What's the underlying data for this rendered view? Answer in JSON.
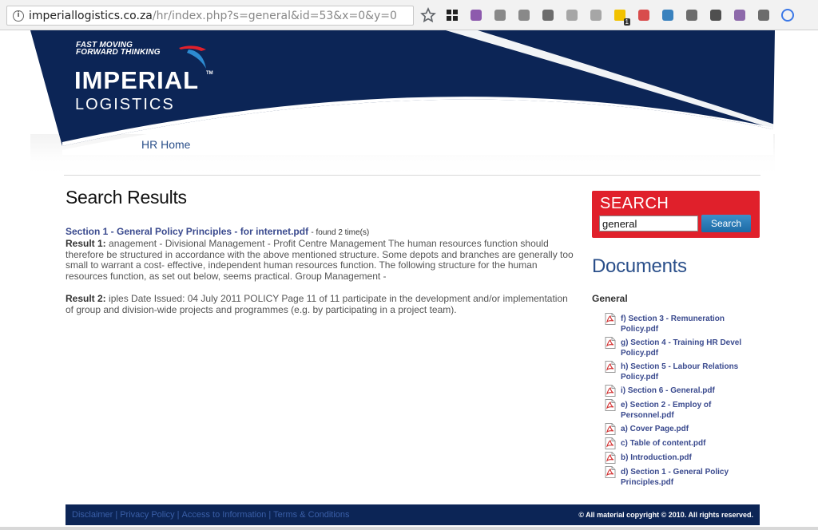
{
  "browser": {
    "url_host": "imperiallogistics.co.za",
    "url_path": "/hr/index.php?s=general&id=53&x=0&y=0",
    "extensions": [
      {
        "name": "bookmark-star-icon",
        "color": "#5f6368"
      },
      {
        "name": "grid-app-icon",
        "color": "#222222"
      },
      {
        "name": "onenote-icon",
        "color": "#7b3fa1"
      },
      {
        "name": "camera-icon",
        "color": "#777777"
      },
      {
        "name": "hourglass-icon",
        "color": "#777777"
      },
      {
        "name": "fish-icon",
        "color": "#555555"
      },
      {
        "name": "drive-icon",
        "color": "#999999"
      },
      {
        "name": "compass-icon",
        "color": "#999999"
      },
      {
        "name": "sticky-note-icon",
        "color": "#f2c200",
        "badge": "1"
      },
      {
        "name": "plus-cross-icon",
        "color": "#d32f2f"
      },
      {
        "name": "board-icon",
        "color": "#1a6fb5"
      },
      {
        "name": "w-circle-icon",
        "color": "#555555"
      },
      {
        "name": "pocket-icon",
        "color": "#333333"
      },
      {
        "name": "viber-icon",
        "color": "#7b519d"
      },
      {
        "name": "s-square-icon",
        "color": "#555555"
      },
      {
        "name": "sync-icon",
        "color": "#3b78e7"
      }
    ]
  },
  "header": {
    "tagline_line1": "FAST MOVING",
    "tagline_line2": "FORWARD THINKING",
    "logo_word": "IMPERIAL",
    "logo_tm": "TM",
    "logo_sub": "LOGISTICS",
    "nav_home": "HR Home",
    "colors": {
      "navy": "#0c2556",
      "swoosh": "#2d8bd1",
      "red": "#e0202b"
    }
  },
  "main": {
    "title": "Search Results",
    "result_file_link": "Section 1 - General Policy Principles - for internet.pdf",
    "found_text": "- found 2 time(s)",
    "results": [
      {
        "label": "Result 1:",
        "text": "anagement - Divisional Management - Profit Centre Management The human resources function should therefore be structured in accordance with the above mentioned structure. Some depots and branches are generally too small to warrant a cost- effective, independent human resources function. The following structure for the human resources function, as set out below, seems practical. Group Management -"
      },
      {
        "label": "Result 2:",
        "text": "iples Date Issued: 04 July 2011 POLICY Page 11 of 11 participate in the development and/or implementation of group and division-wide projects and programmes (e.g. by participating in a project team)."
      }
    ]
  },
  "sidebar": {
    "search_title": "SEARCH",
    "search_value": "general",
    "search_button": "Search",
    "documents_title": "Documents",
    "category": "General",
    "documents": [
      "f) Section 3 - Remuneration Policy.pdf",
      "g) Section 4 - Training HR Devel Policy.pdf",
      "h) Section 5 - Labour Relations Policy.pdf",
      "i) Section 6 - General.pdf",
      "e) Section 2 - Employ of Personnel.pdf",
      "a) Cover Page.pdf",
      "c) Table of content.pdf",
      "b) Introduction.pdf",
      "d) Section 1 - General Policy Principles.pdf"
    ]
  },
  "footer": {
    "links": [
      "Disclaimer",
      "Privacy Policy",
      "Access to Information",
      "Terms & Conditions"
    ],
    "separator": "|",
    "copyright": "© All material copyright © 2010. All rights reserved."
  }
}
